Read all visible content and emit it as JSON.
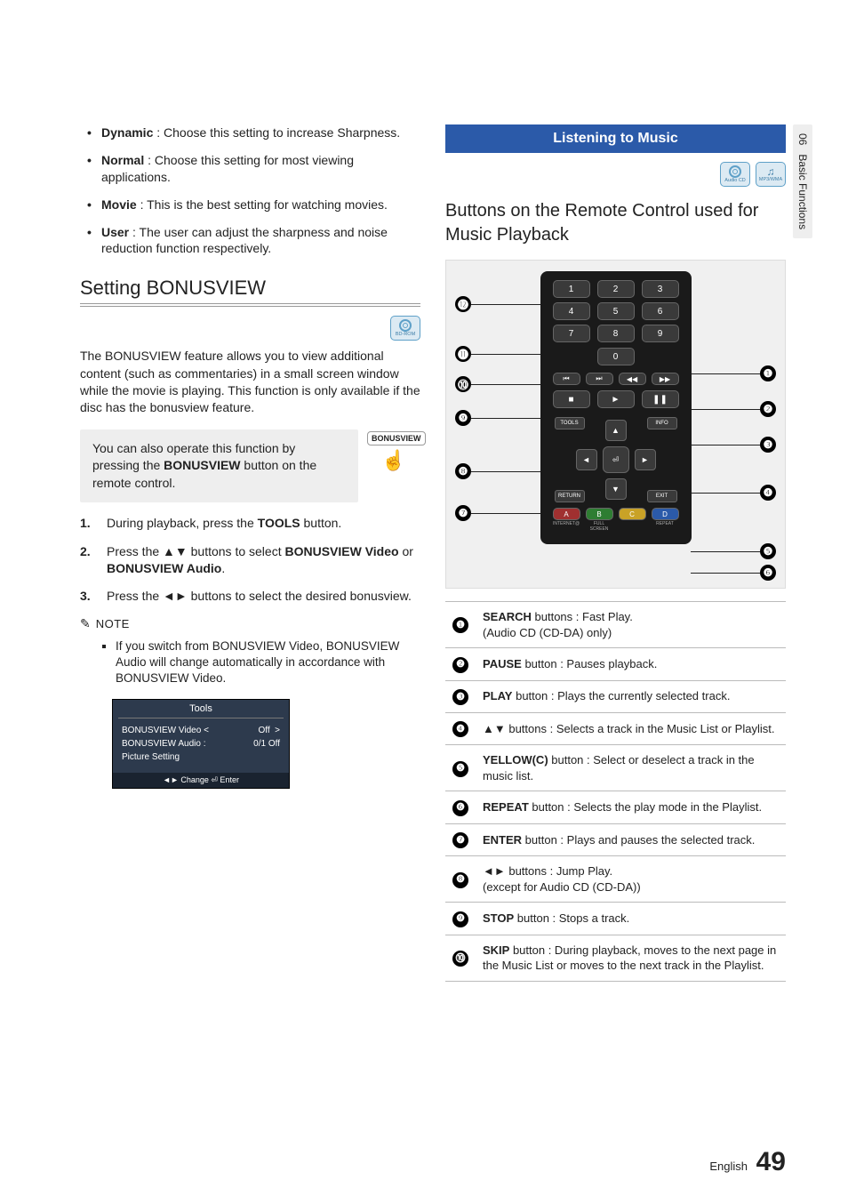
{
  "side_tab": {
    "chapter_num": "06",
    "chapter_title": "Basic Functions"
  },
  "footer": {
    "lang": "English",
    "page": "49"
  },
  "left": {
    "picture_modes": [
      {
        "name": "Dynamic",
        "desc": " : Choose this setting to increase Sharpness."
      },
      {
        "name": "Normal",
        "desc": " : Choose this setting for most viewing applications."
      },
      {
        "name": "Movie",
        "desc": " : This is the best setting for watching movies."
      },
      {
        "name": "User",
        "desc": " : The user can adjust the sharpness and noise reduction function respectively."
      }
    ],
    "bonusview": {
      "heading": "Setting BONUSVIEW",
      "disc_badge": "BD-ROM",
      "intro": "The BONUSVIEW feature allows you to view additional content (such as commentaries) in a small screen window while the movie is playing. This function is only available if the disc has the bonusview feature.",
      "tip_pre": "You can also operate this function by pressing the ",
      "tip_bold": "BONUSVIEW",
      "tip_post": " button on the remote control.",
      "tip_icon_label": "BONUSVIEW",
      "steps": [
        {
          "pre": "During playback, press the ",
          "bold": "TOOLS",
          "post": " button."
        },
        {
          "pre": "Press the ▲▼ buttons to select ",
          "bold": "BONUSVIEW Video",
          "mid": " or ",
          "bold2": "BONUSVIEW Audio",
          "post": "."
        },
        {
          "pre": "Press the ◄► buttons to select the desired bonusview.",
          "bold": "",
          "post": ""
        }
      ],
      "note_label": "NOTE",
      "note_item": "If you switch from BONUSVIEW Video, BONUSVIEW Audio will change automatically in accordance with BONUSVIEW Video.",
      "osd": {
        "title": "Tools",
        "rows": [
          {
            "l": "BONUSVIEW Video <",
            "r": "Off",
            "arrow": ">"
          },
          {
            "l": "BONUSVIEW Audio :",
            "r": "0/1 Off",
            "arrow": ""
          },
          {
            "l": "Picture Setting",
            "r": "",
            "arrow": ""
          }
        ],
        "footer": "◄► Change   ⏎ Enter"
      }
    }
  },
  "right": {
    "ribbon": "Listening to Music",
    "badges": [
      "Audio CD",
      "MP3/WMA"
    ],
    "subtitle": "Buttons on the Remote Control used for Music Playback",
    "remote": {
      "numbers": [
        "1",
        "2",
        "3",
        "4",
        "5",
        "6",
        "7",
        "8",
        "9"
      ],
      "zero": "0",
      "transport": [
        "⏮",
        "⏭",
        "◀◀",
        "▶▶"
      ],
      "play_row": [
        "■",
        "►",
        "❚❚"
      ],
      "dpad": {
        "up": "▲",
        "down": "▼",
        "left": "◄",
        "right": "►",
        "center": "⏎"
      },
      "corners": {
        "tl": "TOOLS",
        "tr": "INFO",
        "bl": "RETURN",
        "br": "EXIT"
      },
      "abc": [
        "A",
        "B",
        "C",
        "D"
      ],
      "abc_sub": [
        "INTERNET@",
        "FULL SCREEN",
        "",
        "REPEAT"
      ]
    },
    "callouts_left": [
      "⓬",
      "⓫",
      "⓾",
      "❾",
      "❽",
      "❼"
    ],
    "callouts_right": [
      "❶",
      "❷",
      "❸",
      "❹",
      "❺",
      "❻"
    ],
    "ref": [
      {
        "n": "❶",
        "bold": "SEARCH",
        "rest": " buttons : Fast Play.",
        "line2": "(Audio CD (CD-DA) only)"
      },
      {
        "n": "❷",
        "bold": "PAUSE",
        "rest": " button : Pauses playback.",
        "line2": ""
      },
      {
        "n": "❸",
        "bold": "PLAY",
        "rest": " button : Plays the currently selected track.",
        "line2": ""
      },
      {
        "n": "❹",
        "bold": "",
        "rest": "▲▼ buttons : Selects a track in the Music List or Playlist.",
        "line2": ""
      },
      {
        "n": "❺",
        "bold": "YELLOW(C)",
        "rest": " button : Select or deselect a track in the music list.",
        "line2": ""
      },
      {
        "n": "❻",
        "bold": "REPEAT",
        "rest": " button : Selects the play mode in the Playlist.",
        "line2": ""
      },
      {
        "n": "❼",
        "bold": "ENTER",
        "rest": " button : Plays and pauses the selected track.",
        "line2": ""
      },
      {
        "n": "❽",
        "bold": "",
        "rest": "◄► buttons : Jump Play.",
        "line2": "(except for Audio CD (CD-DA))"
      },
      {
        "n": "❾",
        "bold": "STOP",
        "rest": " button : Stops a track.",
        "line2": ""
      },
      {
        "n": "⓾",
        "bold": "SKIP",
        "rest": " button : During playback, moves to the next page in the Music List or moves to the next track in the Playlist.",
        "line2": ""
      }
    ]
  }
}
